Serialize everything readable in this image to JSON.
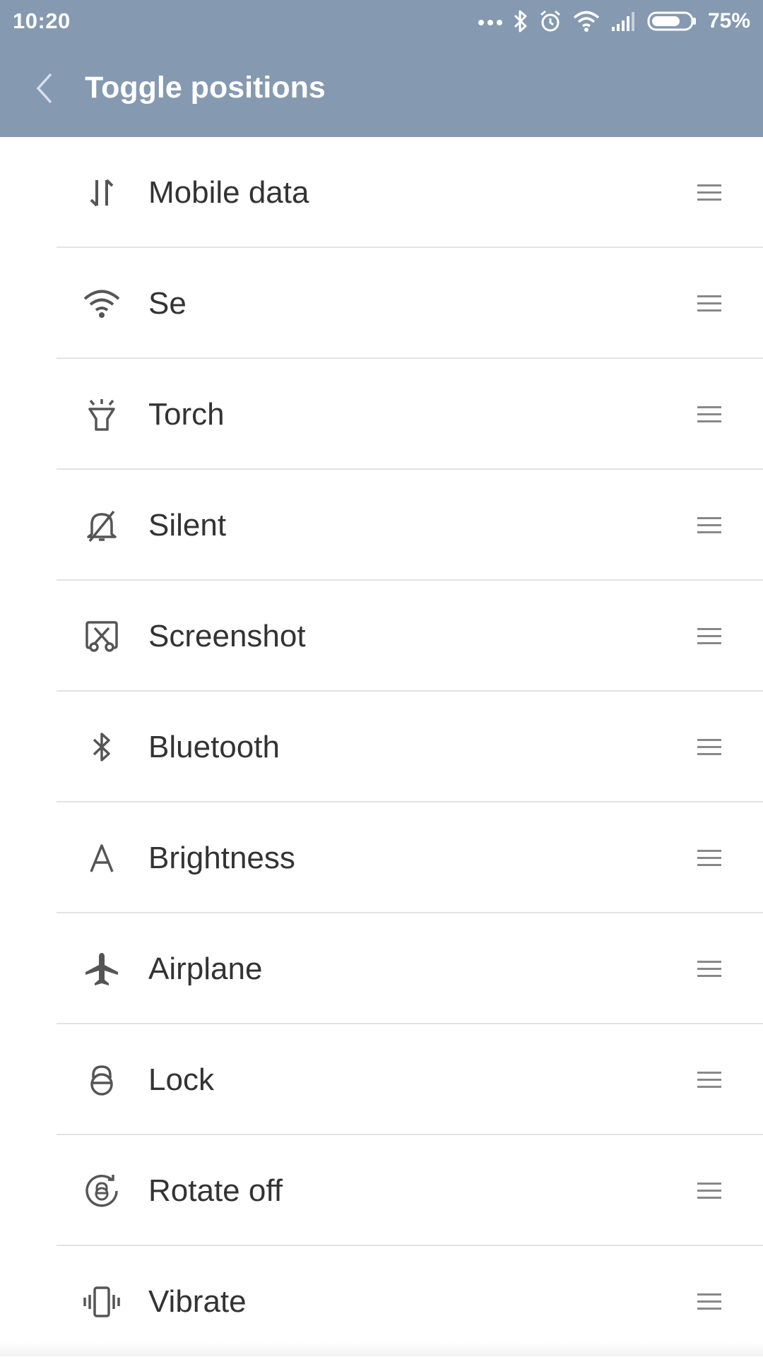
{
  "status_bar": {
    "time": "10:20",
    "battery_percent": "75%",
    "battery_level": 0.75,
    "icons": [
      "more-dots-icon",
      "bluetooth-icon",
      "alarm-icon",
      "wifi-icon",
      "signal-icon",
      "battery-icon"
    ]
  },
  "header": {
    "title": "Toggle positions",
    "back_icon": "back-chevron-icon",
    "background_color": "#8599b1"
  },
  "toggles": [
    {
      "label": "Mobile data",
      "icon": "mobile-data-icon"
    },
    {
      "label": "Se",
      "icon": "wifi-icon"
    },
    {
      "label": "Torch",
      "icon": "torch-icon"
    },
    {
      "label": "Silent",
      "icon": "silent-icon"
    },
    {
      "label": "Screenshot",
      "icon": "screenshot-icon"
    },
    {
      "label": "Bluetooth",
      "icon": "bluetooth-icon"
    },
    {
      "label": "Brightness",
      "icon": "brightness-icon"
    },
    {
      "label": "Airplane",
      "icon": "airplane-icon"
    },
    {
      "label": "Lock",
      "icon": "lock-icon"
    },
    {
      "label": "Rotate off",
      "icon": "rotate-off-icon"
    },
    {
      "label": "Vibrate",
      "icon": "vibrate-icon"
    }
  ],
  "drag_handle_icon": "drag-handle-icon"
}
